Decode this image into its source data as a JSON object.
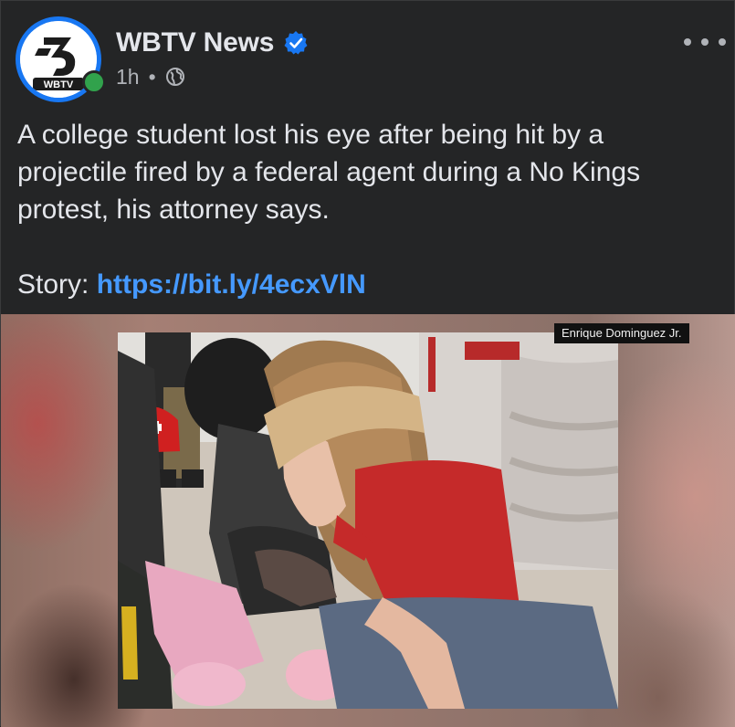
{
  "post": {
    "page_name": "WBTV News",
    "verified_icon": "verified-badge-icon",
    "timestamp": "1h",
    "separator": "•",
    "audience_icon": "globe-icon",
    "avatar_text": "WBTV",
    "more_icon": "more-options-icon",
    "body": "A college student lost his eye after being hit by a projectile fired by a federal agent during a No Kings protest, his attorney says.",
    "story_label": "Story: ",
    "story_link": "https://bit.ly/4ecxVlN"
  },
  "media": {
    "photo_credit": "Enrique Dominguez Jr."
  },
  "colors": {
    "background": "#242526",
    "link": "#4599ff",
    "verified": "#1877f2",
    "online": "#31a24c"
  }
}
